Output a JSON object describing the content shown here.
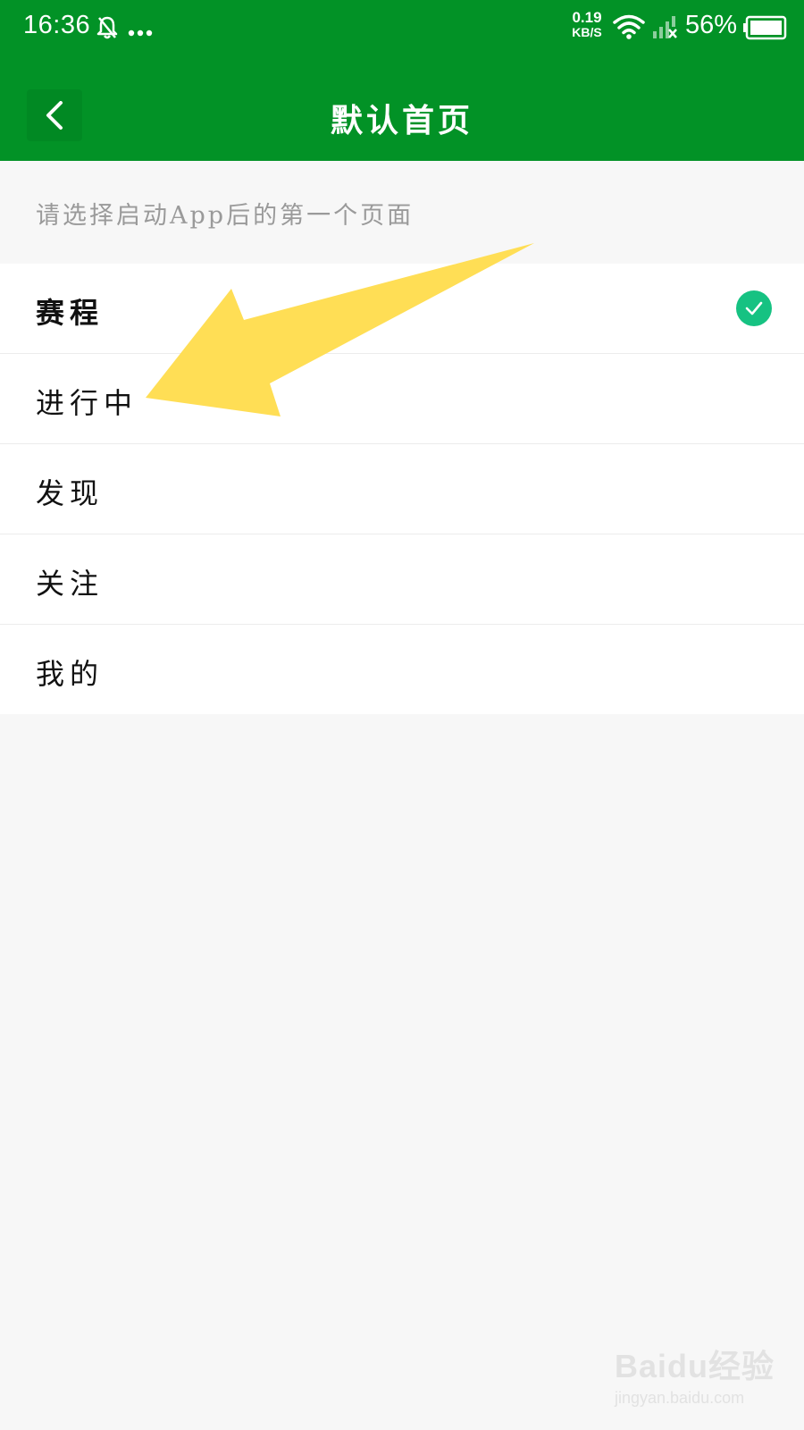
{
  "status_bar": {
    "time": "16:36",
    "net_speed_value": "0.19",
    "net_speed_unit": "KB/S",
    "battery_percent": "56%",
    "icons": [
      "bell-off-icon",
      "more-dots-icon",
      "wifi-icon",
      "signal-no-service-icon",
      "battery-icon"
    ]
  },
  "header": {
    "title": "默认首页",
    "back_icon": "chevron-left-icon"
  },
  "hint": "请选择启动App后的第一个页面",
  "options": [
    {
      "label": "赛程",
      "selected": true
    },
    {
      "label": "进行中",
      "selected": false
    },
    {
      "label": "发现",
      "selected": false
    },
    {
      "label": "关注",
      "selected": false
    },
    {
      "label": "我的",
      "selected": false
    }
  ],
  "watermark": {
    "brand": "Baidu经验",
    "url": "jingyan.baidu.com"
  },
  "colors": {
    "brand_green": "#029226",
    "check_green": "#16c282",
    "arrow_yellow": "#ffde55",
    "background": "#f7f7f7"
  }
}
